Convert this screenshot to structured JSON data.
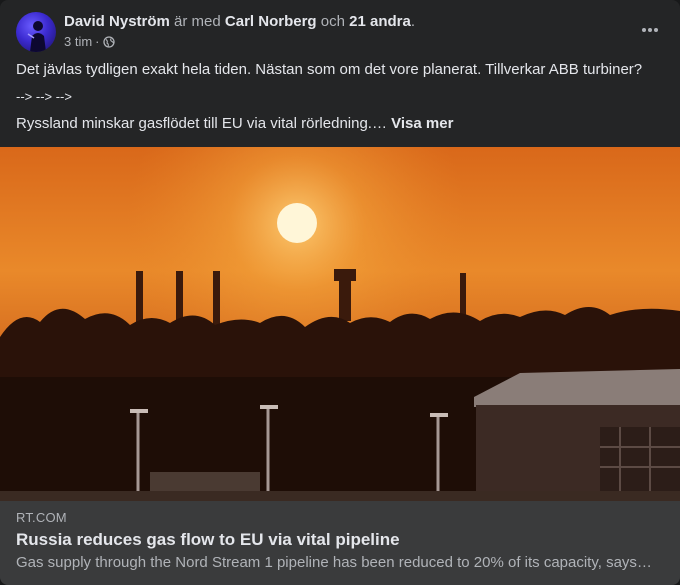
{
  "post": {
    "author": "David Nyström",
    "with_text": "är med",
    "tagged": "Carl Norberg",
    "and_text": "och",
    "others": "21 andra",
    "period": ".",
    "time": "3 tim",
    "dot": "·",
    "privacy_icon": "globe-icon",
    "more_icon": "more-horizontal-icon",
    "line1": "Det jävlas tydligen exakt hela tiden. Nästan som om det vore planerat. Tillverkar ABB turbiner?",
    "line2": "--> --> -->",
    "line3": "Ryssland minskar gasflödet till EU via vital rörledning.…",
    "see_more": "Visa mer"
  },
  "link_preview": {
    "domain": "RT.COM",
    "title": "Russia reduces gas flow to EU via vital pipeline",
    "description": "Gas supply through the Nord Stream 1 pipeline has been reduced to 20% of its capacity, says…"
  },
  "colors": {
    "card": "#242526",
    "link_box": "#3a3b3c",
    "text_primary": "#e4e6eb",
    "text_secondary": "#b0b3b8"
  }
}
